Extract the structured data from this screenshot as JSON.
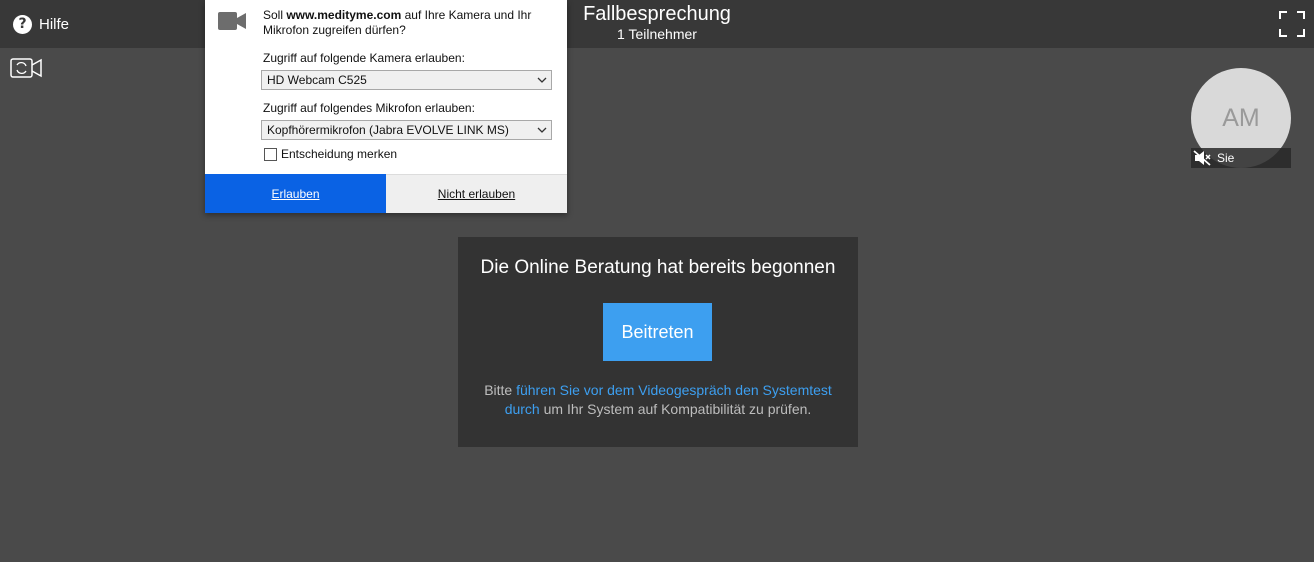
{
  "header": {
    "help_label": "Hilfe",
    "help_icon": "question-circle-icon",
    "title": "Fallbesprechung",
    "participants": "1 Teilnehmer",
    "fullscreen_icon": "fullscreen-icon"
  },
  "toolbar": {
    "camera_toggle_icon": "camera-switch-icon"
  },
  "self_view": {
    "initials": "AM",
    "label": "Sie",
    "mute_icon": "muted-speaker-icon"
  },
  "join_panel": {
    "title": "Die Online Beratung hat bereits begonnen",
    "join_label": "Beitreten",
    "text_before": "Bitte ",
    "link_text": "führen Sie vor dem Videogespräch den Systemtest durch",
    "text_after": " um Ihr System auf Kompatibilität zu prüfen."
  },
  "permission_popup": {
    "question_prefix": "Soll ",
    "site": "www.medityme.com",
    "question_suffix": " auf Ihre Kamera und Ihr Mikrofon zugreifen dürfen?",
    "camera_label": "Zugriff auf folgende Kamera erlauben:",
    "camera_selected": "HD Webcam C525",
    "mic_label": "Zugriff auf folgendes Mikrofon erlauben:",
    "mic_selected": "Kopfhörermikrofon (Jabra EVOLVE LINK MS)",
    "remember_label": "Entscheidung merken",
    "remember_checked": false,
    "allow_label": "Erlauben",
    "deny_label": "Nicht erlauben"
  },
  "colors": {
    "background": "#4a4a4a",
    "topbar": "#383838",
    "panel": "#333333",
    "accent": "#3d9ff0",
    "allow_button": "#0a62e4"
  }
}
